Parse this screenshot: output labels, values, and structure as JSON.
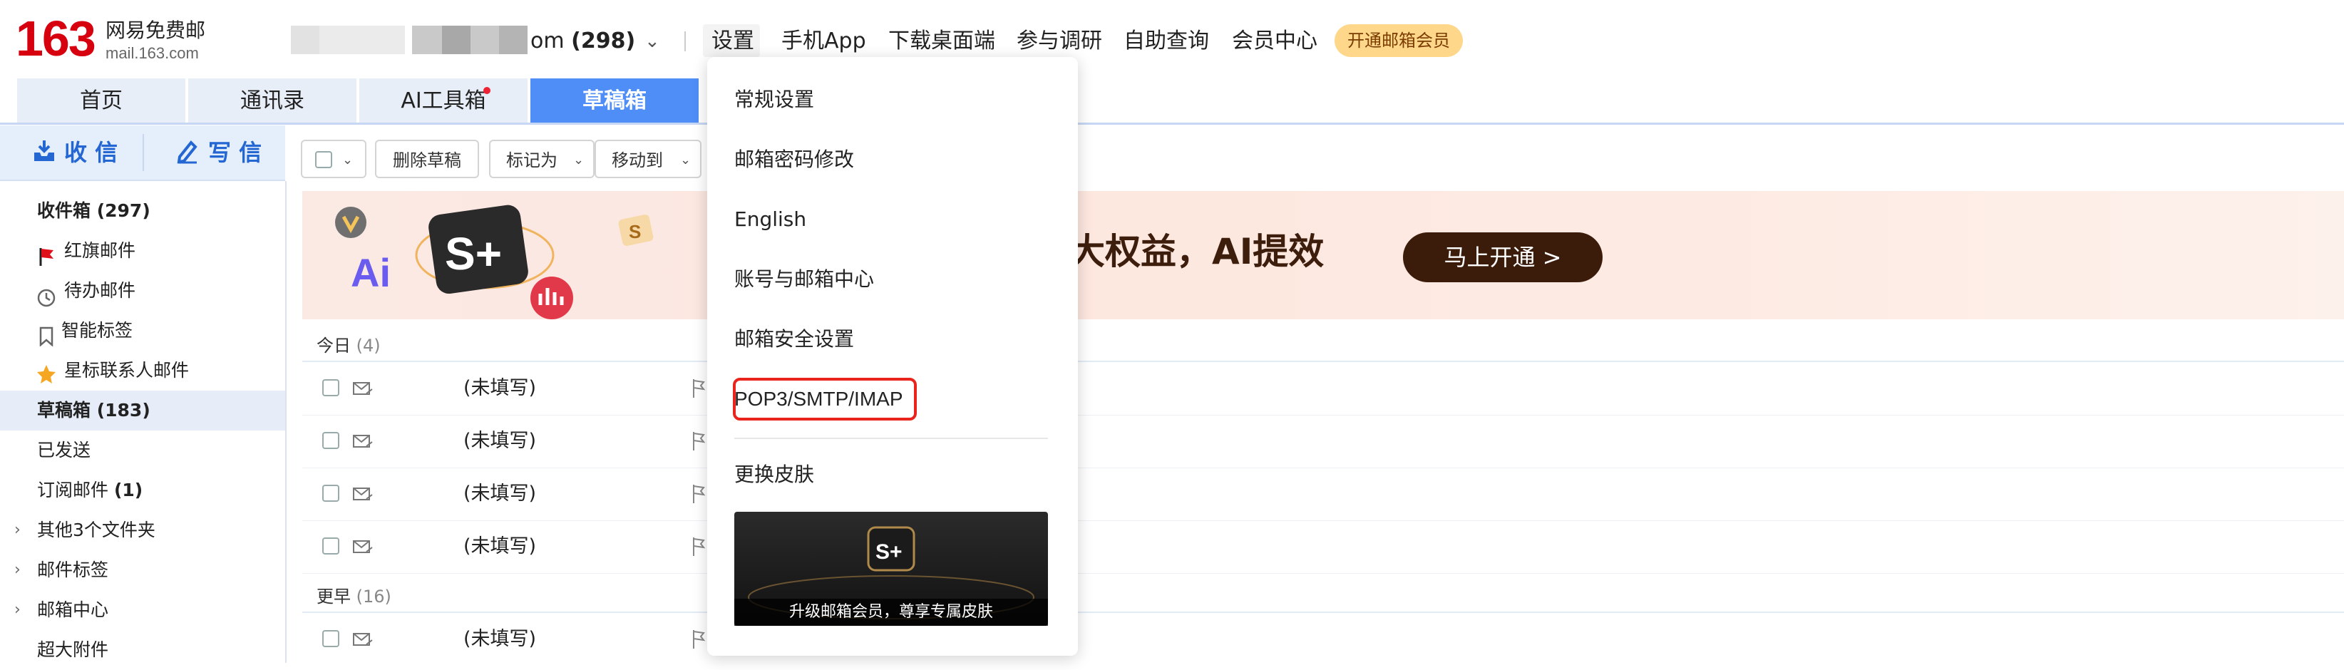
{
  "header": {
    "logo_number": "163",
    "logo_title": "网易免费邮",
    "logo_url": "mail.163.com",
    "account_suffix": "om",
    "account_count": "(298)",
    "nav": [
      "设置",
      "手机App",
      "下载桌面端",
      "参与调研",
      "自助查询",
      "会员中心"
    ],
    "vip_badge": "开通邮箱会员"
  },
  "tabs": [
    "首页",
    "通讯录",
    "AI工具箱",
    "草稿箱"
  ],
  "compose": {
    "receive": "收 信",
    "write": "写 信"
  },
  "folders": [
    {
      "label": "收件箱 ",
      "count": "(297)"
    },
    {
      "label": "红旗邮件"
    },
    {
      "label": "待办邮件"
    },
    {
      "label": "智能标签"
    },
    {
      "label": "星标联系人邮件"
    },
    {
      "label": "草稿箱 ",
      "count": "(183)"
    },
    {
      "label": "已发送"
    },
    {
      "label": "订阅邮件 ",
      "count": "(1)"
    },
    {
      "label": "其他3个文件夹"
    },
    {
      "label": "邮件标签"
    },
    {
      "label": "邮箱中心"
    },
    {
      "label": "超大附件"
    }
  ],
  "toolbar": {
    "delete_draft": "删除草稿",
    "mark_as": "标记为",
    "move_to": "移动到"
  },
  "banner": {
    "text": "大权益，AI提效",
    "button": "马上开通 >"
  },
  "groups": [
    {
      "label": "今日",
      "count": "(4)"
    },
    {
      "label": "更早",
      "count": "(16)"
    }
  ],
  "mail_placeholder": "(未填写)",
  "settings_menu": {
    "items": [
      "常规设置",
      "邮箱密码修改",
      "English",
      "账号与邮箱中心",
      "邮箱安全设置",
      "POP3/SMTP/IMAP",
      "更换皮肤"
    ],
    "skin_caption": "升级邮箱会员，尊享专属皮肤"
  },
  "colors": {
    "brand_red": "#d7000f",
    "tab_active": "#4f8ef7",
    "highlight_border": "#e8241c"
  }
}
